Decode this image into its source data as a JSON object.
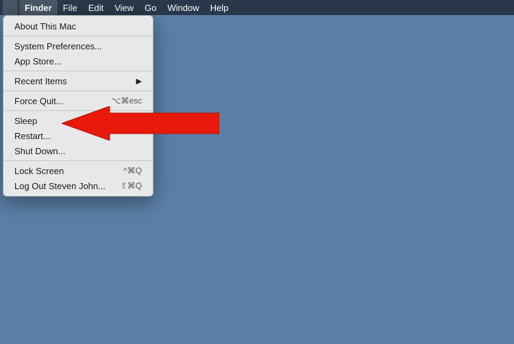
{
  "menubar": {
    "apple_symbol": "",
    "items": [
      {
        "label": "Finder",
        "active": true
      },
      {
        "label": "File",
        "active": false
      },
      {
        "label": "Edit",
        "active": false
      },
      {
        "label": "View",
        "active": false
      },
      {
        "label": "Go",
        "active": false
      },
      {
        "label": "Window",
        "active": false
      },
      {
        "label": "Help",
        "active": false
      }
    ]
  },
  "dropdown": {
    "items": [
      {
        "id": "about",
        "label": "About This Mac",
        "shortcut": "",
        "separator_after": false
      },
      {
        "id": "sep1",
        "separator": true
      },
      {
        "id": "system_prefs",
        "label": "System Preferences...",
        "shortcut": "",
        "separator_after": false
      },
      {
        "id": "app_store",
        "label": "App Store...",
        "shortcut": "",
        "separator_after": false
      },
      {
        "id": "sep2",
        "separator": true
      },
      {
        "id": "recent_items",
        "label": "Recent Items",
        "arrow": "▶",
        "separator_after": false
      },
      {
        "id": "sep3",
        "separator": true
      },
      {
        "id": "force_quit",
        "label": "Force Quit...",
        "shortcut": "⌥⌘esc",
        "separator_after": false
      },
      {
        "id": "sep4",
        "separator": true
      },
      {
        "id": "sleep",
        "label": "Sleep",
        "shortcut": "",
        "separator_after": false
      },
      {
        "id": "restart",
        "label": "Restart...",
        "shortcut": "",
        "separator_after": false
      },
      {
        "id": "shutdown",
        "label": "Shut Down...",
        "shortcut": "",
        "separator_after": false
      },
      {
        "id": "sep5",
        "separator": true
      },
      {
        "id": "lock_screen",
        "label": "Lock Screen",
        "shortcut": "^⌘Q",
        "separator_after": false
      },
      {
        "id": "logout",
        "label": "Log Out Steven John...",
        "shortcut": "⇧⌘Q",
        "separator_after": false
      }
    ]
  },
  "colors": {
    "desktop": "#5b7fa6",
    "arrow": "#e8190a"
  }
}
